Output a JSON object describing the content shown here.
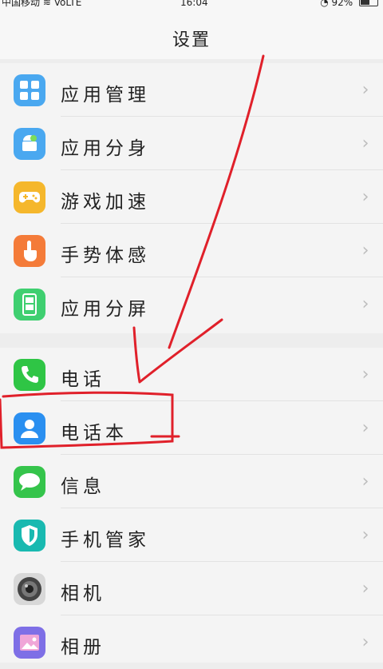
{
  "status_bar": {
    "carrier": "中国移动",
    "network": "VoLTE",
    "time": "16:04",
    "battery": "92%"
  },
  "header": {
    "title": "设置"
  },
  "group1": [
    {
      "label": "应用管理",
      "icon": "grid-icon",
      "color": "#4aa8f0"
    },
    {
      "label": "应用分身",
      "icon": "android-icon",
      "color": "#4aa8f0"
    },
    {
      "label": "游戏加速",
      "icon": "gamepad-icon",
      "color": "#f5b72c"
    },
    {
      "label": "手势体感",
      "icon": "hand-icon",
      "color": "#f47b39"
    },
    {
      "label": "应用分屏",
      "icon": "phone-split-icon",
      "color": "#3fcf70"
    }
  ],
  "group2": [
    {
      "label": "电话",
      "icon": "phone-icon",
      "color": "#2fc545"
    },
    {
      "label": "电话本",
      "icon": "contacts-icon",
      "color": "#2a8ff0"
    },
    {
      "label": "信息",
      "icon": "message-icon",
      "color": "#35c44b"
    },
    {
      "label": "手机管家",
      "icon": "shield-icon",
      "color": "#19b9b0"
    },
    {
      "label": "相机",
      "icon": "camera-icon",
      "color": "#9a9a9a"
    },
    {
      "label": "相册",
      "icon": "gallery-icon",
      "color": "#7e6fe6"
    }
  ],
  "chevron": "›"
}
